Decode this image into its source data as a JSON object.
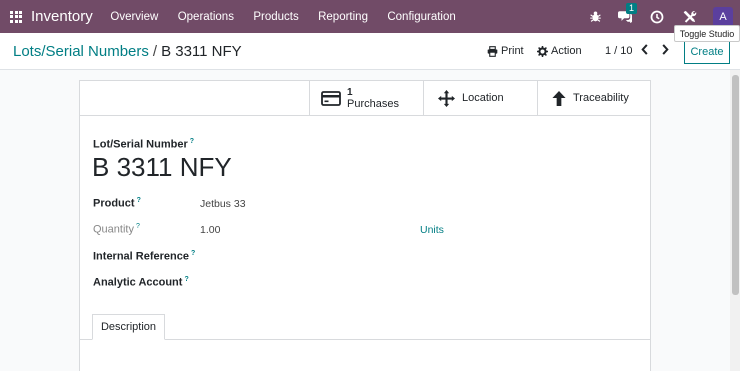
{
  "navbar": {
    "apps_icon": "apps-grid-icon",
    "brand": "Inventory",
    "menu": [
      "Overview",
      "Operations",
      "Products",
      "Reporting",
      "Configuration"
    ],
    "messages_badge": "1",
    "avatar_letter": "A",
    "colors": {
      "bar": "#714b67",
      "badge": "#017e84",
      "avatar": "#5b3f9e"
    }
  },
  "tooltip": {
    "text": "Toggle Studio"
  },
  "control_panel": {
    "breadcrumb_parent": "Lots/Serial Numbers",
    "breadcrumb_separator": "/",
    "breadcrumb_current": "B 3311 NFY",
    "print_label": "Print",
    "action_label": "Action",
    "pager": "1 / 10",
    "create_label": "Create"
  },
  "smart_buttons": {
    "purchases_count": "1",
    "purchases_label": "Purchases",
    "location_label": "Location",
    "traceability_label": "Traceability"
  },
  "form": {
    "lot_label": "Lot/Serial Number",
    "lot_name": "B 3311 NFY",
    "product_label": "Product",
    "product_value": "Jetbus 33",
    "quantity_label": "Quantity",
    "quantity_value": "1.00",
    "uom_value": "Units",
    "internal_ref_label": "Internal Reference",
    "analytic_label": "Analytic Account",
    "help_mark": "?"
  },
  "notebook": {
    "tab_description": "Description"
  }
}
